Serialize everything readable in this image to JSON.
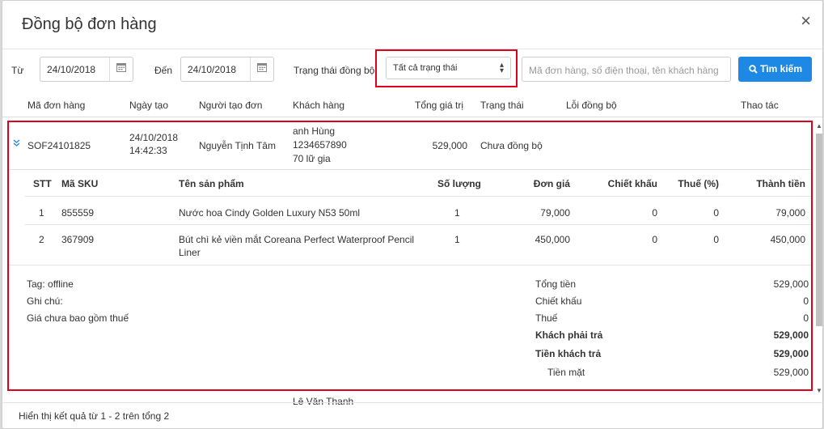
{
  "dialog": {
    "title": "Đồng bộ đơn hàng",
    "close": "×"
  },
  "filters": {
    "from_label": "Từ",
    "from_value": "24/10/2018",
    "to_label": "Đến",
    "to_value": "24/10/2018",
    "status_label": "Trạng thái đồng bộ",
    "status_value": "Tất cả trạng thái",
    "search_placeholder": "Mã đơn hàng, số điện thoại, tên khách hàng",
    "search_button": "Tìm kiếm"
  },
  "columns": [
    "Mã đơn hàng",
    "Ngày tạo",
    "Người tạo đơn",
    "Khách hàng",
    "Tổng giá trị",
    "Trạng thái",
    "Lỗi đồng bộ",
    "Thao tác"
  ],
  "order": {
    "code": "SOF24101825",
    "date": "24/10/2018",
    "time": "14:42:33",
    "creator": "Nguyễn Tịnh Tâm",
    "customer_name": "anh Hùng",
    "customer_phone": "1234657890",
    "customer_address": "70 lữ gia",
    "total": "529,000",
    "status": "Chưa đồng bộ"
  },
  "item_columns": [
    "STT",
    "Mã SKU",
    "Tên sản phẩm",
    "Số lượng",
    "Đơn giá",
    "Chiết khấu",
    "Thuế (%)",
    "Thành tiền"
  ],
  "items": [
    {
      "stt": "1",
      "sku": "855559",
      "name": "Nước hoa Cindy Golden Luxury N53 50ml",
      "name2": "",
      "qty": "1",
      "price": "79,000",
      "discount": "0",
      "tax": "0",
      "amount": "79,000"
    },
    {
      "stt": "2",
      "sku": "367909",
      "name": "Bút chì kẻ viền mắt Coreana Perfect Waterproof Pencil",
      "name2": "Liner",
      "qty": "1",
      "price": "450,000",
      "discount": "0",
      "tax": "0",
      "amount": "450,000"
    }
  ],
  "notes": {
    "tag": "Tag: offline",
    "note": "Ghi chú:",
    "tax_note": "Giá chưa bao gồm thuế"
  },
  "summary": {
    "total_label": "Tổng tiền",
    "total_value": "529,000",
    "discount_label": "Chiết khấu",
    "discount_value": "0",
    "tax_label": "Thuế",
    "tax_value": "0",
    "payable_label": "Khách phải trả",
    "payable_value": "529,000",
    "paid_label": "Tiền khách trả",
    "paid_value": "529,000",
    "cash_label": "Tiền mặt",
    "cash_value": "529,000"
  },
  "next_row_peek": "Lê Văn Thanh",
  "footer": "Hiển thị kết quả từ 1 - 2 trên tổng 2",
  "colors": {
    "accent": "#1e88e5",
    "highlight": "#e0001b"
  }
}
